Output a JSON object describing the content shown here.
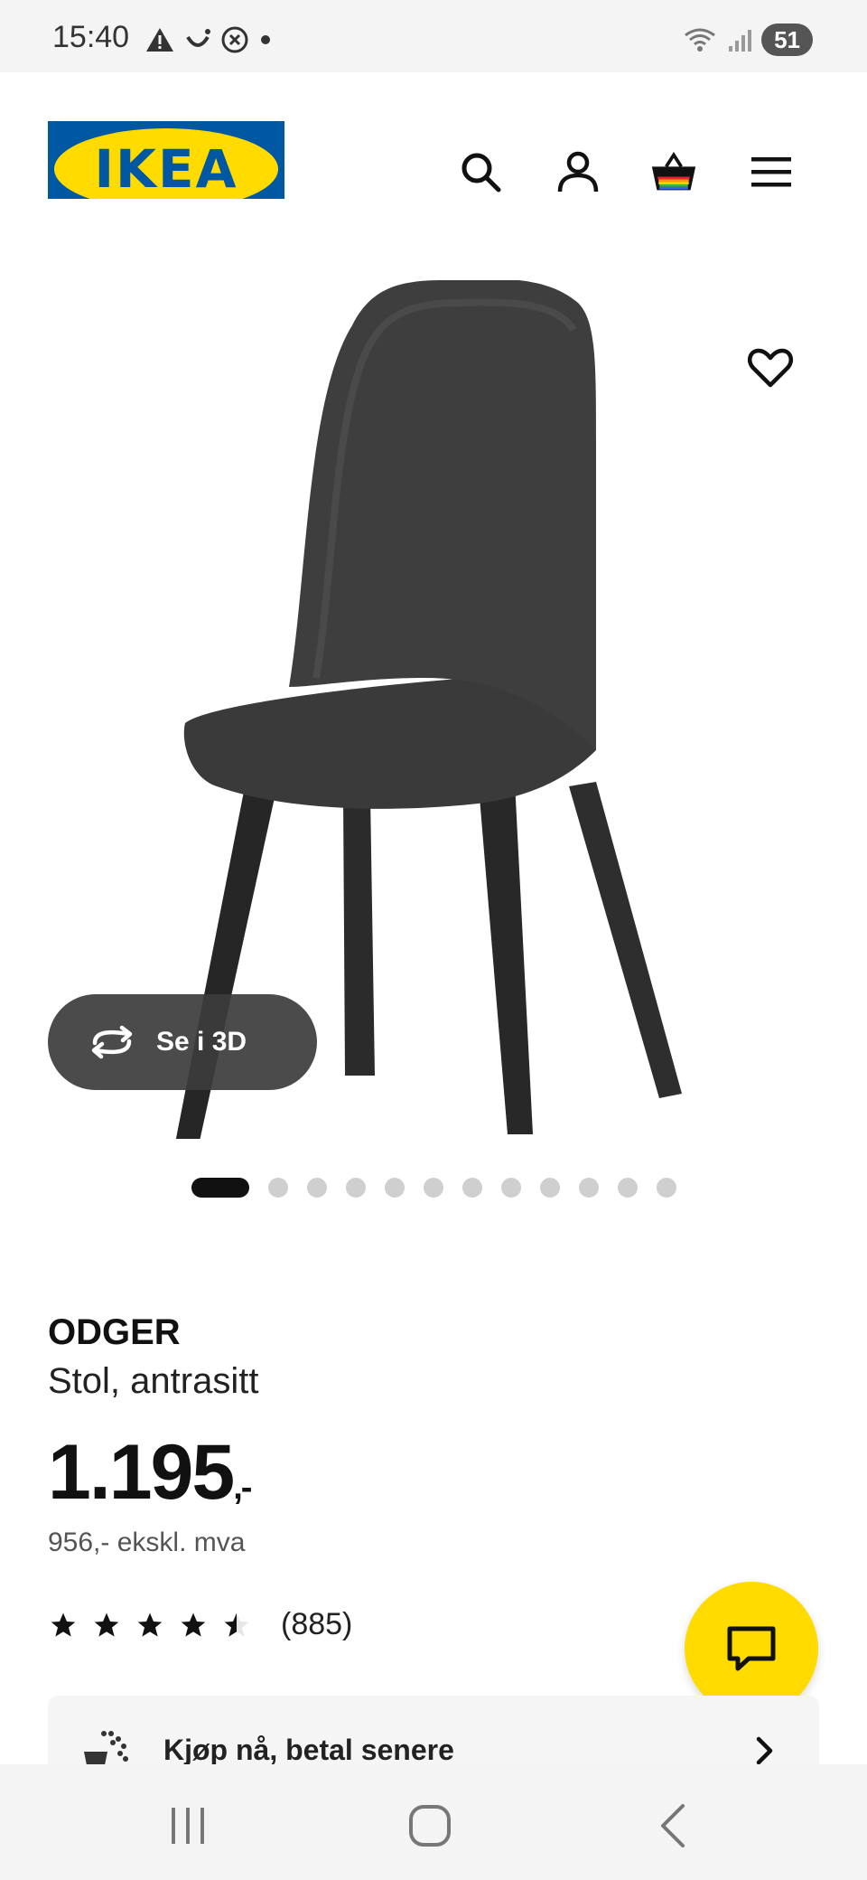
{
  "status_bar": {
    "time": "15:40",
    "battery": "51",
    "icons": [
      "warning-icon",
      "smile-icon",
      "shazam-icon",
      "notification-dot-icon",
      "wifi-icon",
      "signal-icon"
    ]
  },
  "header": {
    "logo_text": "IKEA",
    "icons": [
      "search-icon",
      "user-icon",
      "basket-icon",
      "menu-icon"
    ]
  },
  "gallery": {
    "view_3d_label": "Se i 3D",
    "total_images": 12,
    "active_index": 0
  },
  "product": {
    "name": "ODGER",
    "description": "Stol, antrasitt",
    "price": "1.195",
    "price_suffix": ",-",
    "price_ex_vat": "956,- ekskl. mva",
    "rating_value": 4.5,
    "rating_count": "(885)"
  },
  "payment_banner": {
    "label": "Kjøp nå, betal senere"
  },
  "colors": {
    "ikea_blue": "#0058a3",
    "ikea_yellow": "#ffdb00"
  }
}
